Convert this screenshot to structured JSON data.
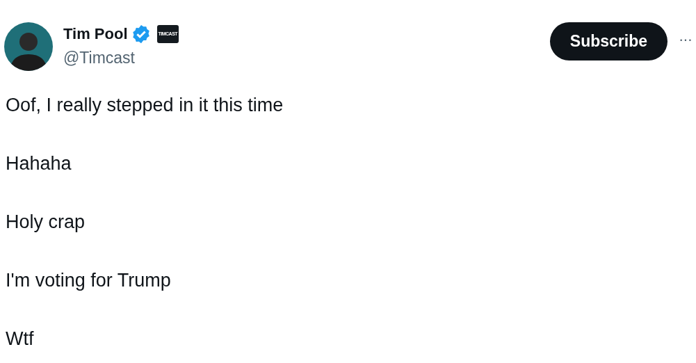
{
  "author": {
    "name": "Tim Pool",
    "verified": true,
    "affiliate_badge": "TIMCAST",
    "handle": "@Timcast"
  },
  "actions": {
    "subscribe": "Subscribe",
    "more": "···"
  },
  "tweet": {
    "paragraphs": [
      "Oof, I really stepped in it this time",
      "Hahaha",
      "Holy crap",
      "I'm voting for Trump",
      "Wtf"
    ]
  }
}
